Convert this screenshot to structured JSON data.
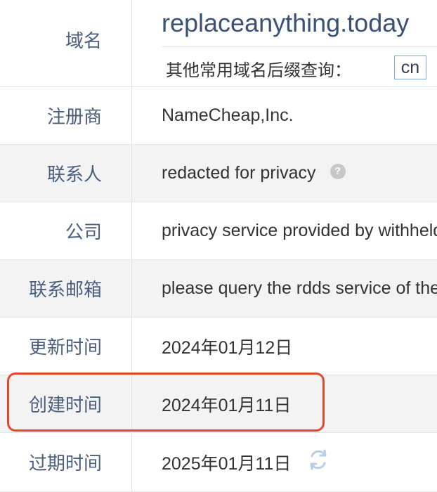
{
  "domain": {
    "label": "域名",
    "value": "replaceanything.today",
    "suffix_prompt": "其他常用域名后缀查询：",
    "suffix_chip": "cn"
  },
  "rows": {
    "registrar": {
      "label": "注册商",
      "value": "NameCheap,Inc."
    },
    "contact": {
      "label": "联系人",
      "value": "redacted for privacy"
    },
    "company": {
      "label": "公司",
      "value": "privacy service provided by withheld for privacy ehf"
    },
    "email": {
      "label": "联系邮箱",
      "value": "please query the rdds service of the registrar of record"
    },
    "updated": {
      "label": "更新时间",
      "value": "2024年01月12日"
    },
    "created": {
      "label": "创建时间",
      "value": "2024年01月11日"
    },
    "expires": {
      "label": "过期时间",
      "value": "2025年01月11日"
    }
  },
  "icons": {
    "help": "help-icon",
    "refresh": "refresh-icon"
  },
  "colors": {
    "label_text": "#4b5f7d",
    "domain_text": "#3a5075",
    "highlight": "#e24a2e",
    "alt_row": "#f3f3f3",
    "chip_border": "#7da7d9"
  }
}
